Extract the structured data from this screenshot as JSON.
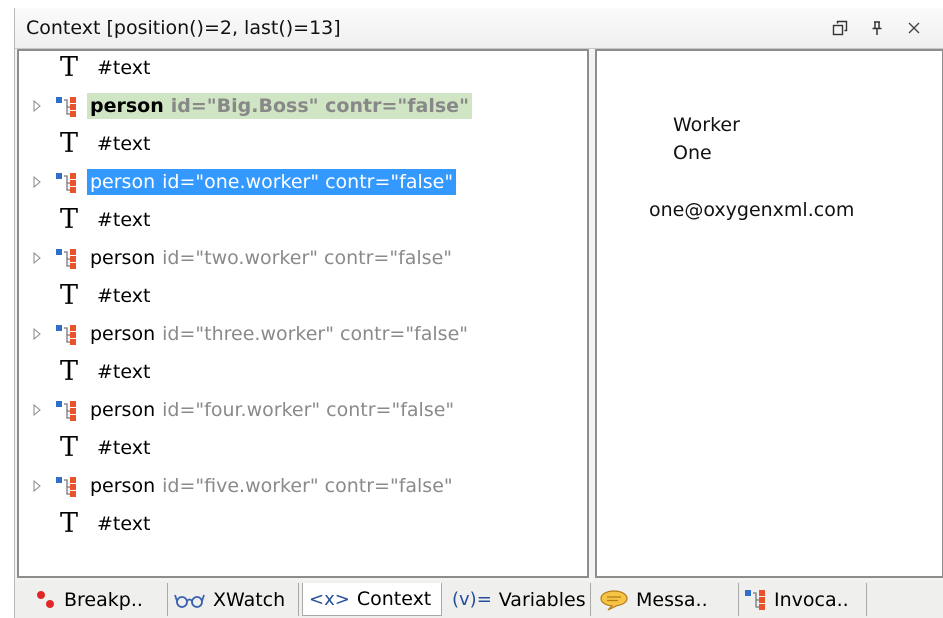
{
  "window": {
    "title": "Context [position()=2, last()=13]"
  },
  "tree": {
    "rows": [
      {
        "kind": "text",
        "label": "#text"
      },
      {
        "kind": "element",
        "name": "person",
        "attrs": "id=\"Big.Boss\" contr=\"false\"",
        "state": "context"
      },
      {
        "kind": "text",
        "label": "#text"
      },
      {
        "kind": "element",
        "name": "person",
        "attrs": "id=\"one.worker\" contr=\"false\"",
        "state": "selected"
      },
      {
        "kind": "text",
        "label": "#text"
      },
      {
        "kind": "element",
        "name": "person",
        "attrs": "id=\"two.worker\" contr=\"false\"",
        "state": "normal"
      },
      {
        "kind": "text",
        "label": "#text"
      },
      {
        "kind": "element",
        "name": "person",
        "attrs": "id=\"three.worker\" contr=\"false\"",
        "state": "normal"
      },
      {
        "kind": "text",
        "label": "#text"
      },
      {
        "kind": "element",
        "name": "person",
        "attrs": "id=\"four.worker\" contr=\"false\"",
        "state": "normal"
      },
      {
        "kind": "text",
        "label": "#text"
      },
      {
        "kind": "element",
        "name": "person",
        "attrs": "id=\"five.worker\" contr=\"false\"",
        "state": "normal"
      },
      {
        "kind": "text",
        "label": "#text"
      }
    ]
  },
  "preview": {
    "line1": "Worker",
    "line2": "One",
    "email": "one@oxygenxml.com"
  },
  "tabs": [
    {
      "label": "Breakp..",
      "icon": "breakpoints-icon"
    },
    {
      "label": "XWatch",
      "icon": "glasses-icon"
    },
    {
      "label": "Context",
      "icon": "context-icon",
      "active": true
    },
    {
      "label": "Variables",
      "icon": "variables-icon"
    },
    {
      "label": "Messa..",
      "icon": "speech-bubble-icon"
    },
    {
      "label": "Invoca..",
      "icon": "invocation-tree-icon"
    }
  ],
  "colors": {
    "selection": "#3399ff",
    "context_highlight": "#cfe5c4",
    "attribute_text": "#8a8a8a"
  }
}
